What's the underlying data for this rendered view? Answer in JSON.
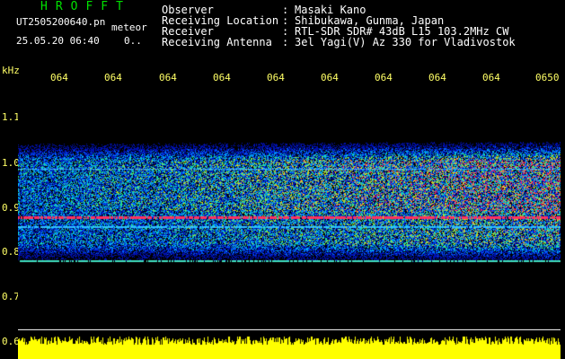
{
  "header": {
    "brand": "HROFFT",
    "file_name": "UT2505200640.pn",
    "tag": "meteor",
    "date_time": "25.05.20 06:40",
    "small_status": "0.."
  },
  "info": {
    "rows": [
      {
        "label": "Observer",
        "sep": ":",
        "value": "Masaki Kano"
      },
      {
        "label": "Receiving Location",
        "sep": ":",
        "value": "Shibukawa, Gunma, Japan"
      },
      {
        "label": "Receiver",
        "sep": ":",
        "value": "RTL-SDR SDR# 43dB L15 103.2MHz CW"
      },
      {
        "label": "Receiving Antenna",
        "sep": ":",
        "value": "3el Yagi(V) Az 330 for Vladivostok"
      }
    ]
  },
  "axis": {
    "unit": "kHz",
    "time_ticks": [
      "064",
      "064",
      "064",
      "064",
      "064",
      "064",
      "064",
      "064",
      "064",
      "0650"
    ],
    "freq_ticks": [
      "1.1",
      "1.0",
      "0.9",
      "0.8",
      "0.7",
      "0.6"
    ]
  },
  "colors": {
    "background": "#000000",
    "header_text": "#ffffff",
    "brand_text": "#00e000",
    "axis_text": "#ffff66",
    "noise_strip": "#ffff00",
    "spectrum_low": "#0000a0",
    "spectrum_mid": "#00e0e0",
    "spectrum_high": "#ff2060"
  }
}
